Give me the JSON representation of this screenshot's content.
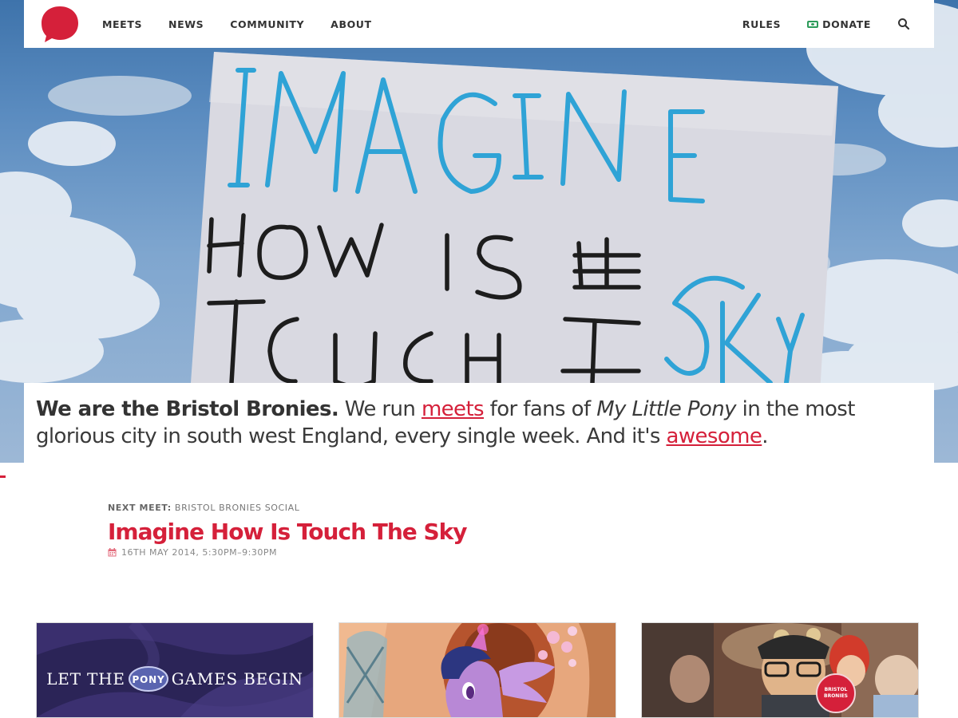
{
  "nav": {
    "items": [
      {
        "label": "MEETS"
      },
      {
        "label": "NEWS"
      },
      {
        "label": "COMMUNITY"
      },
      {
        "label": "ABOUT"
      }
    ],
    "right": {
      "rules": "RULES",
      "donate": "DONATE"
    },
    "icons": [
      "speech-bubble-logo",
      "banknote-icon",
      "search-icon"
    ]
  },
  "hero": {
    "sign_lines": [
      "IMAGINE",
      "HOW IS",
      "TOUCH",
      "THE",
      "SKY"
    ]
  },
  "intro": {
    "bold": "We are the Bristol Bronies.",
    "t1": " We run ",
    "link1": "meets",
    "t2": " for fans of ",
    "italic": "My Little Pony",
    "t3": " in the most glorious city in south west England, every single week. And it's ",
    "link2": "awesome",
    "t4": "."
  },
  "next_meet": {
    "label": "NEXT MEET:",
    "group": "BRISTOL BRONIES SOCIAL",
    "title": "Imagine How Is Touch The Sky",
    "date": "16TH MAY 2014, 5:30PM–9:30PM"
  },
  "cards": [
    {
      "text_before": "LET THE",
      "badge": "PONY",
      "text_after": "GAMES BEGIN"
    },
    {
      "text": ""
    },
    {
      "badge": "BRISTOL BRONIES"
    }
  ],
  "colors": {
    "accent": "#d5203a",
    "donate_green": "#2d9b5a",
    "sky": "#5b8cc0"
  }
}
